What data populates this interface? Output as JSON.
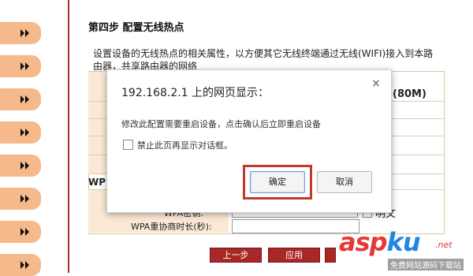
{
  "page": {
    "step_title": "第四步 配置无线热点",
    "description": "设置设备的无线热点的相关属性，以方便其它无线终端通过无线(WIFI)接入到本路由器，共享路由器的网络",
    "rate_label": "(80M)",
    "section_label": "WP",
    "wpa_password_label": "WPA密钥:",
    "wpa_password_value": "••••••••••••",
    "show_password_label": "明文",
    "wpa_renew_label": "WPA重协商时长(秒):",
    "prev_button": "上一步",
    "apply_button": "应用"
  },
  "dialog": {
    "title": "192.168.2.1 上的网页显示：",
    "close_symbol": "×",
    "message": "修改此配置需要重启设备，点击确认后立即重启设备",
    "suppress_label": "禁止此页再显示对话框。",
    "ok_label": "确定",
    "cancel_label": "取消"
  },
  "watermark": {
    "brand_a": "asp",
    "brand_k": "ku",
    "brand_net": ".net",
    "sub": "免费网站源码下载站"
  },
  "colors": {
    "sidebar_button": "#f6b98b",
    "accent_red": "#a82727",
    "highlight": "#c0392b"
  }
}
